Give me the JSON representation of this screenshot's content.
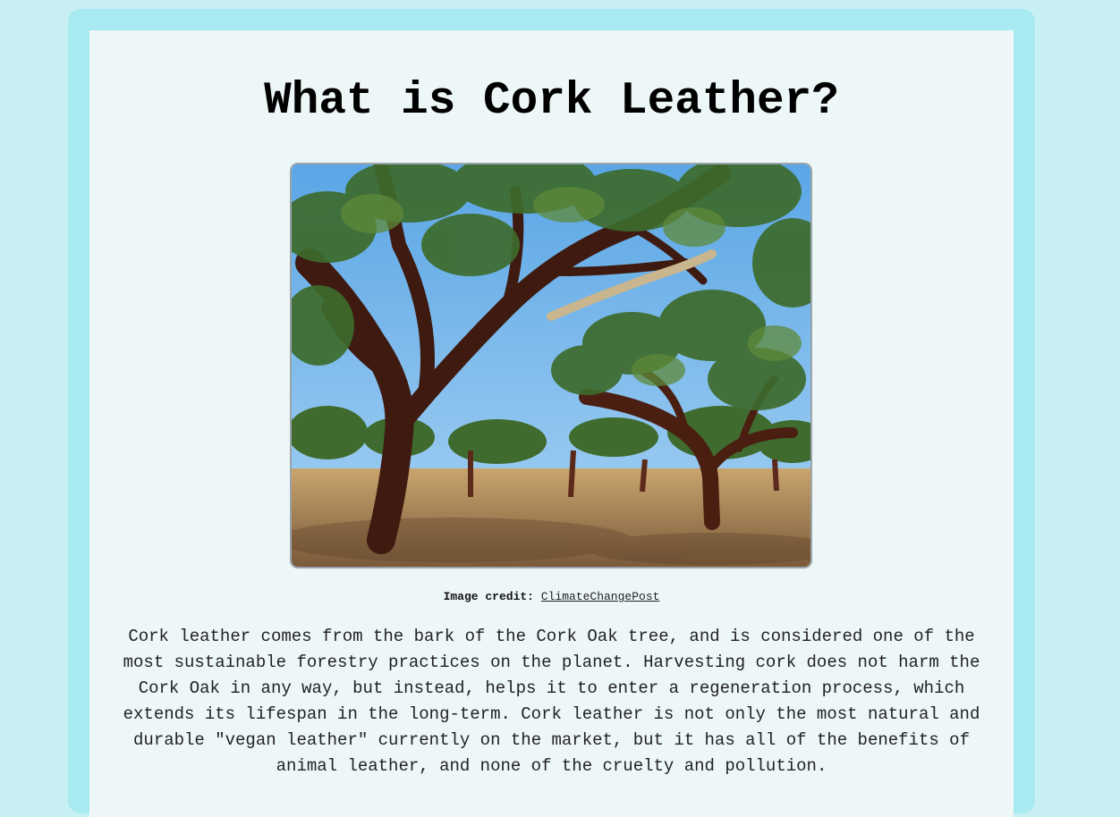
{
  "article": {
    "title": "What is Cork Leather?",
    "image": {
      "alt": "Cork oak trees in a sunlit grove"
    },
    "credit": {
      "label": "Image credit:",
      "link_text": "ClimateChangePost"
    },
    "paragraph": "Cork leather comes from the bark of the Cork Oak tree, and is considered one of the most sustainable forestry practices on the planet. Harvesting cork does not harm the Cork Oak in any way, but instead, helps it to enter a regeneration process, which extends its lifespan in the long-term. Cork leather is not only the most natural and durable \"vegan leather\" currently on the market, but it has all of the benefits of animal leather, and none of the cruelty and pollution."
  },
  "colors": {
    "page_background": "#c8f0f2",
    "frame": "#a9eaf2",
    "card": "#eef7f8"
  }
}
